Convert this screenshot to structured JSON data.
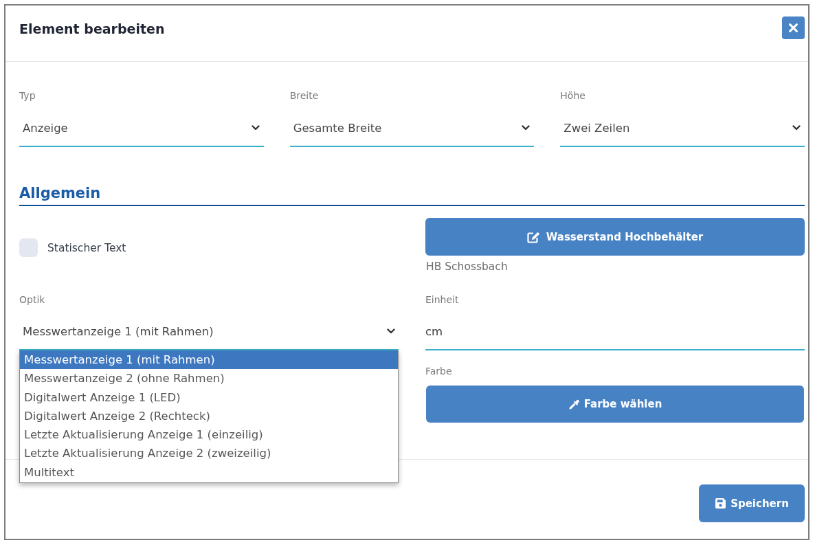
{
  "dialog": {
    "title": "Element bearbeiten"
  },
  "selects": [
    {
      "label": "Typ",
      "value": "Anzeige"
    },
    {
      "label": "Breite",
      "value": "Gesamte Breite"
    },
    {
      "label": "Höhe",
      "value": "Zwei Zeilen"
    }
  ],
  "section": {
    "title": "Allgemein"
  },
  "static_text_checkbox": {
    "label": "Statischer Text",
    "checked": false
  },
  "data_point": {
    "button": "Wasserstand Hochbehälter",
    "caption": "HB Schossbach"
  },
  "optik": {
    "label": "Optik",
    "value": "Messwertanzeige 1 (mit Rahmen)",
    "expanded": true,
    "options": [
      {
        "label": "Messwertanzeige 1 (mit Rahmen)",
        "selected": true
      },
      {
        "label": "Messwertanzeige 2 (ohne Rahmen)",
        "selected": false
      },
      {
        "label": "Digitalwert Anzeige 1 (LED)",
        "selected": false
      },
      {
        "label": "Digitalwert Anzeige 2 (Rechteck)",
        "selected": false
      },
      {
        "label": "Letzte Aktualisierung Anzeige 1 (einzeilig)",
        "selected": false
      },
      {
        "label": "Letzte Aktualisierung Anzeige 2 (zweizeilig)",
        "selected": false
      },
      {
        "label": "Multitext",
        "selected": false
      }
    ]
  },
  "einheit": {
    "label": "Einheit",
    "value": "cm"
  },
  "farbe": {
    "label": "Farbe",
    "button": "Farbe wählen"
  },
  "footer": {
    "save_button": "Speichern"
  }
}
